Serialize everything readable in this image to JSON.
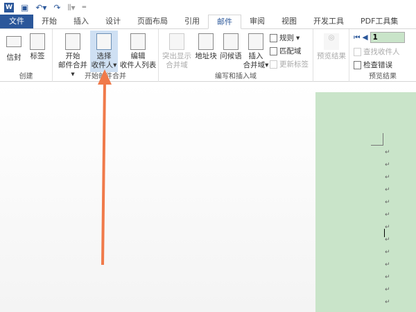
{
  "qat": {
    "logo": "W"
  },
  "tabs": [
    "文件",
    "开始",
    "插入",
    "设计",
    "页面布局",
    "引用",
    "邮件",
    "审阅",
    "视图",
    "开发工具",
    "PDF工具集"
  ],
  "groups": {
    "create": {
      "label": "创建",
      "envelope": "信封",
      "labels": "标签"
    },
    "start": {
      "label": "开始邮件合并",
      "start_l1": "开始",
      "start_l2": "邮件合并",
      "select_l1": "选择",
      "select_l2": "收件人",
      "edit_l1": "编辑",
      "edit_l2": "收件人列表"
    },
    "write": {
      "label": "编写和插入域",
      "highlight_l1": "突出显示",
      "highlight_l2": "合并域",
      "address": "地址块",
      "greeting": "问候语",
      "insert_l1": "插入",
      "insert_l2": "合并域",
      "rules": "规则",
      "match": "匹配域",
      "update": "更新标签"
    },
    "preview": {
      "label": "预览结果",
      "preview_btn": "预览结果",
      "record": "1",
      "find": "查找收件人",
      "check": "检查错误"
    }
  },
  "document": {
    "paragraph_mark": "↵"
  },
  "colors": {
    "accent": "#2b579a",
    "arrow": "#f07a4a",
    "page": "#c9e4c9"
  }
}
